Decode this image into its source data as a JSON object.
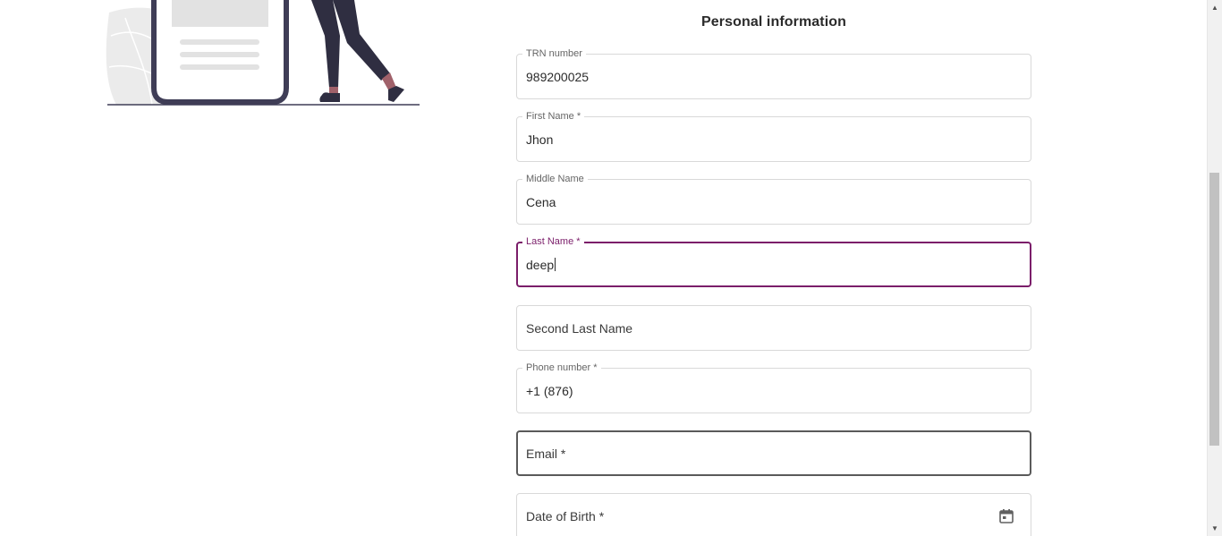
{
  "form": {
    "title": "Personal information",
    "accent_color": "#7b1e6a",
    "fields": {
      "trn": {
        "label": "TRN number",
        "value": "989200025"
      },
      "first_name": {
        "label": "First Name *",
        "value": "Jhon"
      },
      "middle_name": {
        "label": "Middle Name",
        "value": "Cena"
      },
      "last_name": {
        "label": "Last Name *",
        "value": "deep"
      },
      "second_last_name": {
        "placeholder": "Second Last Name"
      },
      "phone": {
        "label": "Phone number *",
        "value": "+1 (876)"
      },
      "email": {
        "placeholder": "Email *"
      },
      "dob": {
        "placeholder": "Date of Birth *",
        "icon": "calendar-icon"
      }
    }
  },
  "scrollbar": {
    "up_arrow": "▲",
    "down_arrow": "▼"
  }
}
